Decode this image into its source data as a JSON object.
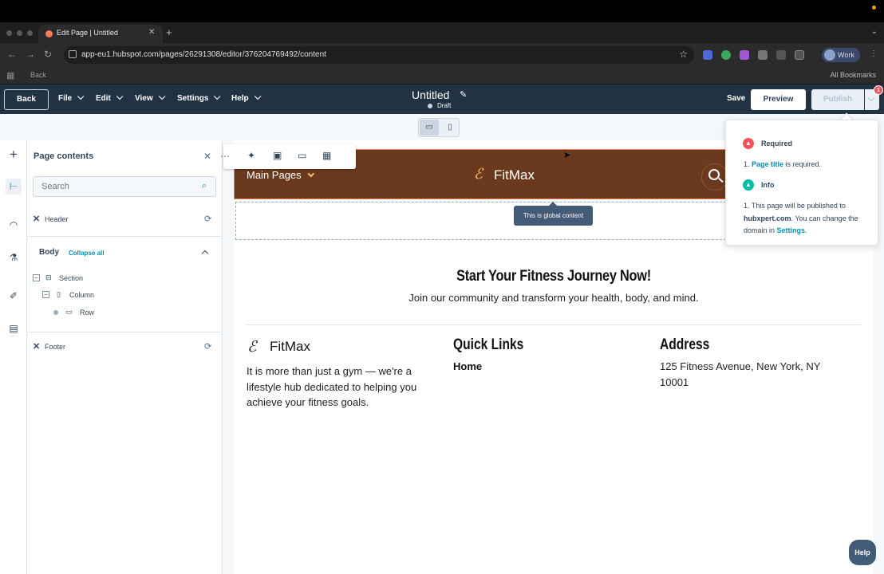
{
  "browser": {
    "tab_title": "Edit Page | Untitled",
    "url": "app-eu1.hubspot.com/pages/26291308/editor/376204769492/content",
    "bookmark_back": "Back",
    "all_bookmarks": "All Bookmarks",
    "profile_label": "Work"
  },
  "header": {
    "back_label": "Back",
    "menus": [
      "File",
      "Edit",
      "View",
      "Settings",
      "Help"
    ],
    "page_title": "Untitled",
    "status": "Draft",
    "save_label": "Save",
    "preview_label": "Preview",
    "publish_label": "Publish",
    "badge_count": "1"
  },
  "panel": {
    "title": "Page contents",
    "search_placeholder": "Search",
    "header_item": "Header",
    "body_label": "Body",
    "collapse_all": "Collapse all",
    "tree": [
      "Section",
      "Column",
      "Row"
    ],
    "footer_item": "Footer"
  },
  "canvas": {
    "nav_label": "Main Pages",
    "logo_text": "FitMax",
    "global_tooltip": "This is global content",
    "headline": "Start Your Fitness Journey Now!",
    "subheadline": "Join our community and transform your health, body, and mind.",
    "footer": {
      "logo_text": "FitMax",
      "description": "It is more than just a gym — we're a lifestyle hub dedicated to helping you achieve your fitness goals.",
      "quick_links_title": "Quick Links",
      "quick_link_home": "Home",
      "address_title": "Address",
      "address_text": "125 Fitness Avenue, New York, NY 10001"
    }
  },
  "popover": {
    "required_title": "Required",
    "required_item_link": "Page title",
    "required_item_rest": " is required.",
    "info_title": "Info",
    "info_text_1": "This page will be published to ",
    "info_domain": "hubxpert.com",
    "info_text_2": ". You can change the domain in ",
    "info_settings_link": "Settings",
    "info_text_3": "."
  },
  "help_label": "Help",
  "colors": {
    "hs_header": "#213343",
    "accent": "#0091ae",
    "site_header_brown": "#6b3a1e",
    "logo_gold": "#f5c26b",
    "required_red": "#f2545b",
    "info_teal": "#00bda5"
  }
}
